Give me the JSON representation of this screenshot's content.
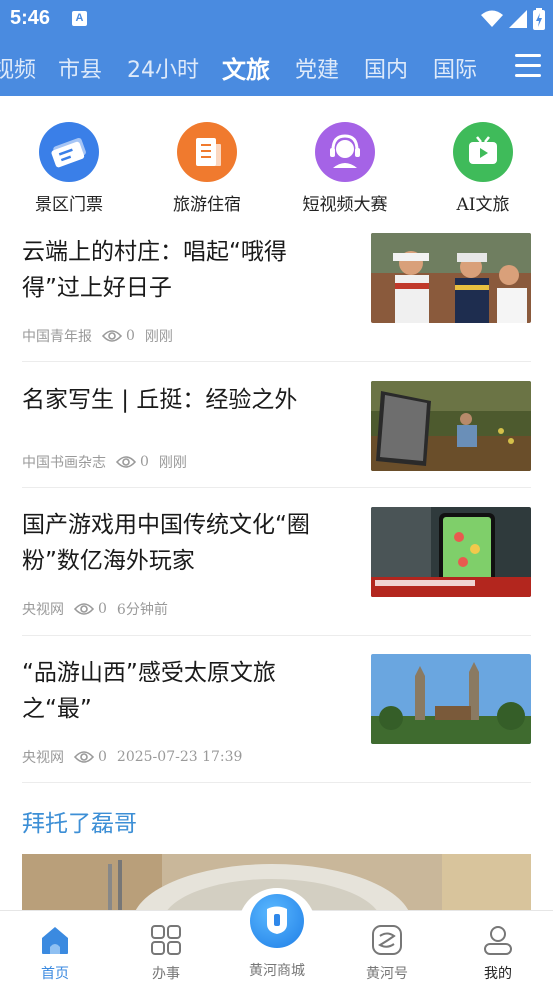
{
  "status_bar": {
    "time": "5:46",
    "notification_letter": "A"
  },
  "tabs": [
    {
      "label": "视频",
      "active": false
    },
    {
      "label": "市县",
      "active": false
    },
    {
      "label": "24小时",
      "active": false
    },
    {
      "label": "文旅",
      "active": true
    },
    {
      "label": "党建",
      "active": false
    },
    {
      "label": "国内",
      "active": false
    },
    {
      "label": "国际",
      "active": false
    }
  ],
  "quick_links": [
    {
      "label": "景区门票",
      "icon": "ticket-icon",
      "color": "#3a7fe8"
    },
    {
      "label": "旅游住宿",
      "icon": "hotel-icon",
      "color": "#f07a2e"
    },
    {
      "label": "短视频大赛",
      "icon": "headset-icon",
      "color": "#a563e6"
    },
    {
      "label": "AI文旅",
      "icon": "tv-play-icon",
      "color": "#3fbb5a"
    }
  ],
  "news": [
    {
      "title": "云端上的村庄：唱起“哦得得”过上好日子",
      "source": "中国青年报",
      "views": "0",
      "time": "刚刚"
    },
    {
      "title": "名家写生 | 丘挺：经验之外",
      "source": "中国书画杂志",
      "views": "0",
      "time": "刚刚"
    },
    {
      "title": "国产游戏用中国传统文化“圈粉”数亿海外玩家",
      "source": "央视网",
      "views": "0",
      "time": "6分钟前"
    },
    {
      "title": "“品游山西”感受太原文旅之“最”",
      "source": "央视网",
      "views": "0",
      "time": "2025-07-23 17:39"
    }
  ],
  "section": {
    "title": "拜托了磊哥"
  },
  "bottom_nav": {
    "home": "首页",
    "services": "办事",
    "mall": "黄河商城",
    "account": "黄河号",
    "mine": "我的"
  },
  "colors": {
    "brand": "#4a8be0",
    "section_title": "#3d8fd6",
    "active_nav": "#3b8ae0"
  }
}
